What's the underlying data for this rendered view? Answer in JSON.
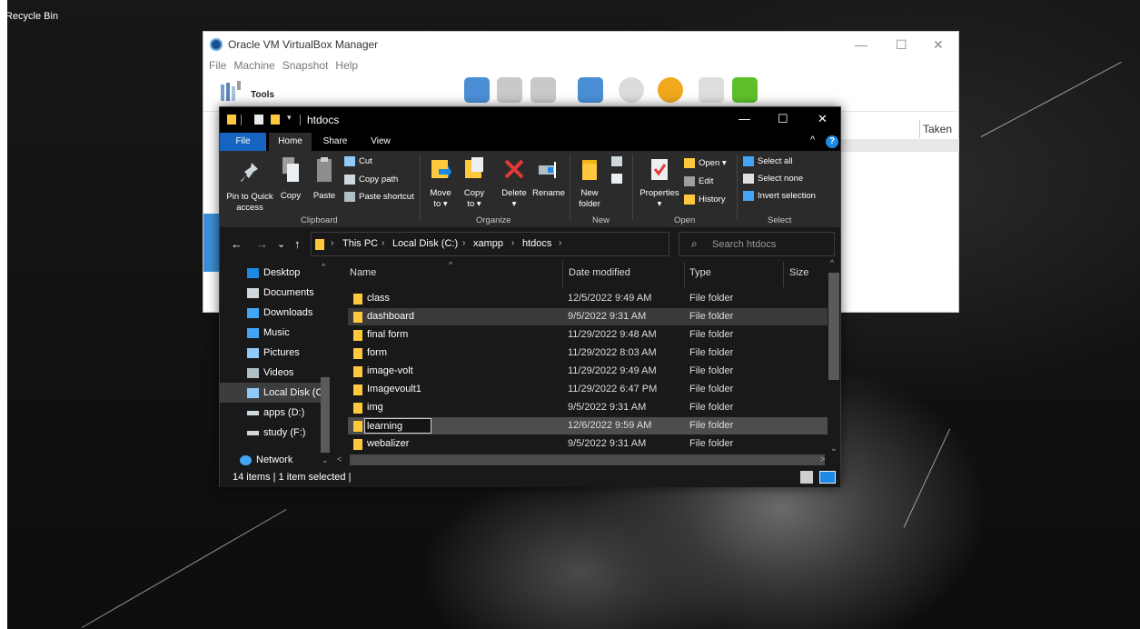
{
  "desktop": {
    "recycle_bin_label": "Recycle Bin"
  },
  "vbox": {
    "title": "Oracle VM VirtualBox Manager",
    "menu": [
      "File",
      "Machine",
      "Snapshot",
      "Help"
    ],
    "tools_label": "Tools",
    "column_taken": "Taken",
    "controls": {
      "minimize": "—",
      "maximize": "☐",
      "close": "✕"
    }
  },
  "explorer": {
    "title": "htdocs",
    "qa_dropdown": "▾",
    "controls": {
      "minimize": "—",
      "maximize": "☐",
      "close": "✕"
    },
    "tabs": {
      "file": "File",
      "home": "Home",
      "share": "Share",
      "view": "View"
    },
    "ribbon_collapse": "^",
    "help": "?",
    "ribbon": {
      "clipboard": {
        "group": "Clipboard",
        "pin": [
          "Pin to Quick",
          "access"
        ],
        "copy": "Copy",
        "paste": "Paste",
        "cut": "Cut",
        "copy_path": "Copy path",
        "paste_shortcut": "Paste shortcut"
      },
      "organize": {
        "group": "Organize",
        "move_to": [
          "Move",
          "to ▾"
        ],
        "copy_to": [
          "Copy",
          "to ▾"
        ],
        "delete": [
          "Delete",
          "▾"
        ],
        "rename": "Rename"
      },
      "new": {
        "group": "New",
        "new_folder": [
          "New",
          "folder"
        ]
      },
      "open": {
        "group": "Open",
        "properties": [
          "Properties",
          "▾"
        ],
        "open": "Open ▾",
        "edit": "Edit",
        "history": "History"
      },
      "select": {
        "group": "Select",
        "select_all": "Select all",
        "select_none": "Select none",
        "invert_selection": "Invert selection"
      }
    },
    "nav_buttons": {
      "back": "←",
      "forward": "→",
      "recent": "⌄",
      "up": "↑"
    },
    "address": {
      "crumbs": [
        "This PC",
        "Local Disk (C:)",
        "xampp",
        "htdocs"
      ],
      "separator": "›",
      "dropdown": "⌄",
      "refresh": "↻"
    },
    "search": {
      "icon": "⌕",
      "placeholder": "Search htdocs"
    },
    "nav_pane": [
      {
        "label": "Desktop",
        "icon": "desktop-icon",
        "color": "#1e88e5"
      },
      {
        "label": "Documents",
        "icon": "documents-icon",
        "color": "#cfd8dc"
      },
      {
        "label": "Downloads",
        "icon": "downloads-icon",
        "color": "#42a5f5"
      },
      {
        "label": "Music",
        "icon": "music-icon",
        "color": "#42a5f5"
      },
      {
        "label": "Pictures",
        "icon": "pictures-icon",
        "color": "#90caf9"
      },
      {
        "label": "Videos",
        "icon": "videos-icon",
        "color": "#b0bec5"
      },
      {
        "label": "Local Disk (C:)",
        "icon": "local-disk-icon",
        "color": "#90caf9"
      },
      {
        "label": "apps (D:)",
        "icon": "drive-icon",
        "color": "#cfd8dc"
      },
      {
        "label": "study (F:)",
        "icon": "drive-icon",
        "color": "#cfd8dc"
      },
      {
        "label": "Network",
        "icon": "network-icon",
        "color": "#42a5f5"
      }
    ],
    "nav_scroll": {
      "up": "^",
      "down": "⌄"
    },
    "columns": {
      "name": "Name",
      "date": "Date modified",
      "type": "Type",
      "size": "Size"
    },
    "sort_caret": "^",
    "files": [
      {
        "name": "class",
        "date": "12/5/2022 9:49 AM",
        "type": "File folder"
      },
      {
        "name": "dashboard",
        "date": "9/5/2022 9:31 AM",
        "type": "File folder"
      },
      {
        "name": "final form",
        "date": "11/29/2022 9:48 AM",
        "type": "File folder"
      },
      {
        "name": "form",
        "date": "11/29/2022 8:03 AM",
        "type": "File folder"
      },
      {
        "name": "image-volt",
        "date": "11/29/2022 9:49 AM",
        "type": "File folder"
      },
      {
        "name": "Imagevoult1",
        "date": "11/29/2022 6:47 PM",
        "type": "File folder"
      },
      {
        "name": "img",
        "date": "9/5/2022 9:31 AM",
        "type": "File folder"
      },
      {
        "name": "learning",
        "date": "12/6/2022 9:59 AM",
        "type": "File folder"
      },
      {
        "name": "webalizer",
        "date": "9/5/2022 9:31 AM",
        "type": "File folder"
      }
    ],
    "rename_value": "learning",
    "scroll": {
      "up": "^",
      "down": "⌄",
      "left": "<",
      "right": ">"
    },
    "status": "14 items  |  1 item selected  |"
  }
}
